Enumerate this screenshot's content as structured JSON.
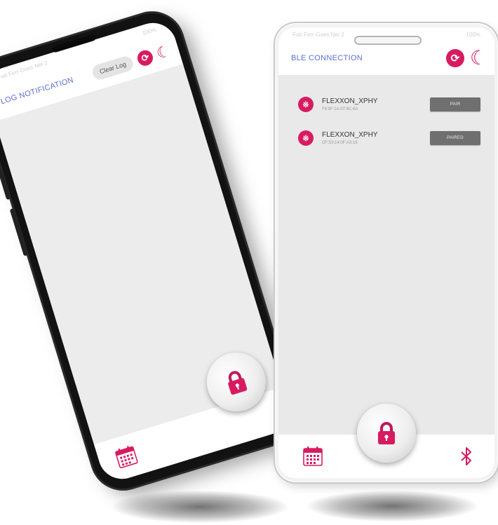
{
  "left_phone": {
    "title": "LOG NOTIFICATION",
    "clear_button": "Clear Log",
    "status_left": "Fab Ferr-Goes Net 2",
    "status_right": "100%"
  },
  "right_phone": {
    "title": "BLE CONNECTION",
    "status_left": "Fab Ferr-Goes Net 2",
    "status_right": "100%",
    "devices": [
      {
        "name": "FLEXXON_XPHY",
        "address": "F8:9F:1A:07:6C:6A",
        "button": "PAIR"
      },
      {
        "name": "FLEXXON_XPHY",
        "address": "DF:53:14:0F:A3:18",
        "button": "PAIRED"
      }
    ]
  },
  "colors": {
    "accent": "#d81b60",
    "title_blue": "#5b6fd0",
    "button_gray": "#6f6f6f"
  },
  "icons": [
    "refresh-icon",
    "moon-icon",
    "bluetooth-icon",
    "lock-icon",
    "calendar-icon"
  ]
}
